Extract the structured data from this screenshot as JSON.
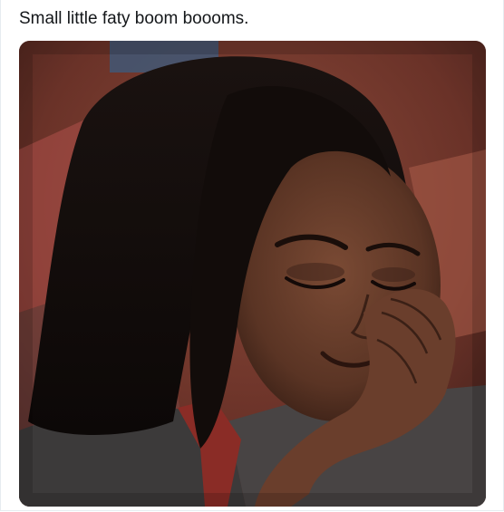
{
  "tweet": {
    "text": "Small little faty boom boooms."
  },
  "media": {
    "type": "photo",
    "icon": "photo"
  },
  "colors": {
    "text": "#14171a",
    "border": "#e6ecf0",
    "background": "#ffffff"
  }
}
